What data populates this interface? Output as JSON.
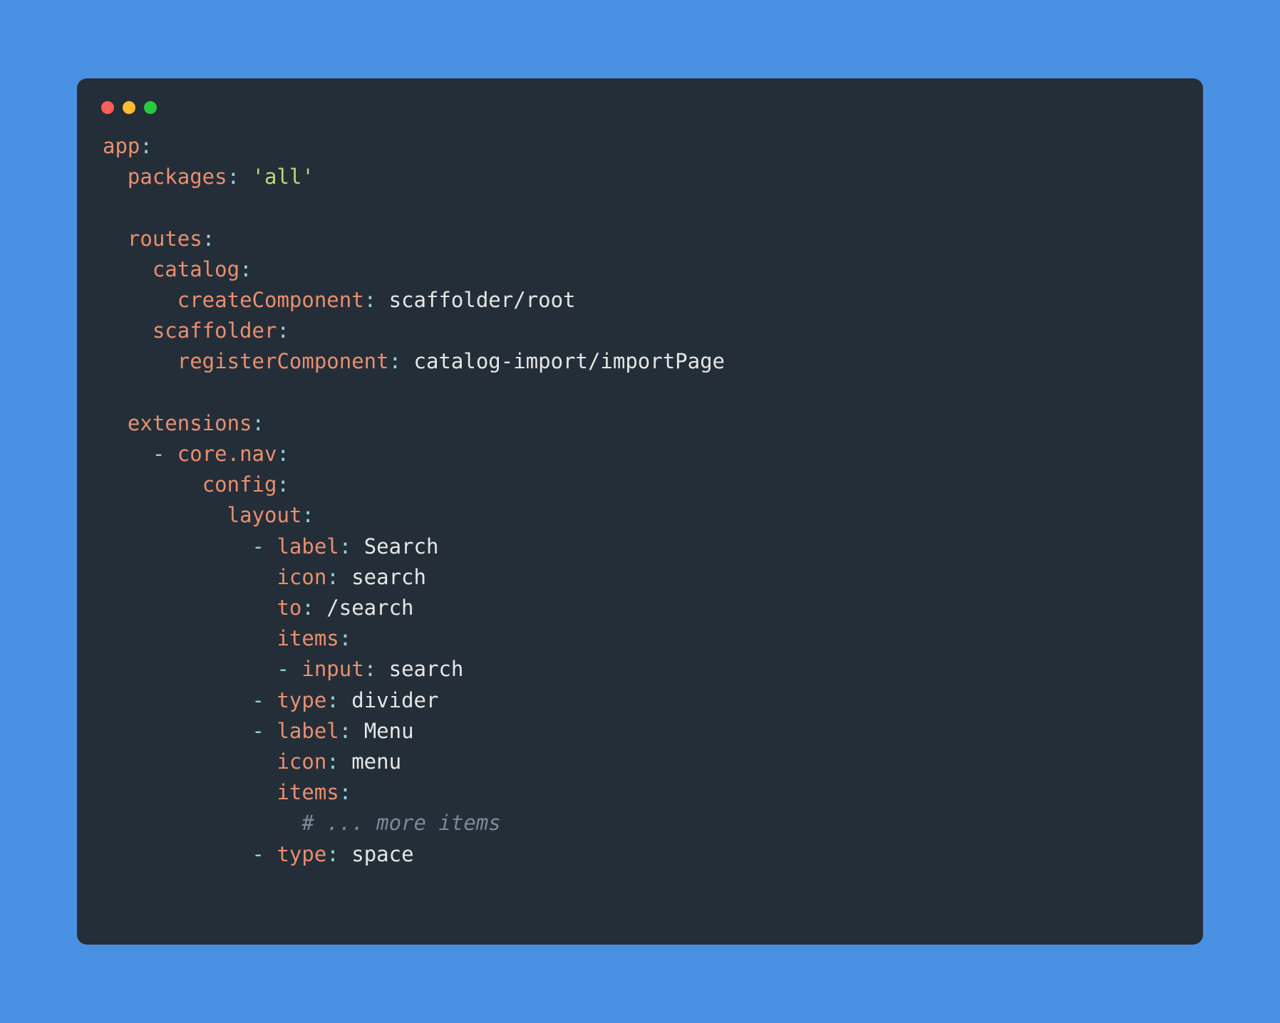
{
  "code": {
    "app": {
      "packages_key": "packages",
      "packages_val": "'all'",
      "routes_key": "routes",
      "catalog_key": "catalog",
      "createComponent_key": "createComponent",
      "createComponent_val": "scaffolder/root",
      "scaffolder_key": "scaffolder",
      "registerComponent_key": "registerComponent",
      "registerComponent_val": "catalog-import/importPage",
      "extensions_key": "extensions",
      "corenav_key": "core.nav",
      "config_key": "config",
      "layout_key": "layout",
      "label_key": "label",
      "label_search_val": "Search",
      "icon_key": "icon",
      "icon_search_val": "search",
      "to_key": "to",
      "to_search_val": "/search",
      "items_key": "items",
      "input_key": "input",
      "input_search_val": "search",
      "type_key": "type",
      "type_divider_val": "divider",
      "label_menu_val": "Menu",
      "icon_menu_val": "menu",
      "comment_more": "# ... more items",
      "type_space_val": "space",
      "app_key": "app"
    }
  },
  "punct": {
    "colon": ":",
    "dash": "-"
  }
}
